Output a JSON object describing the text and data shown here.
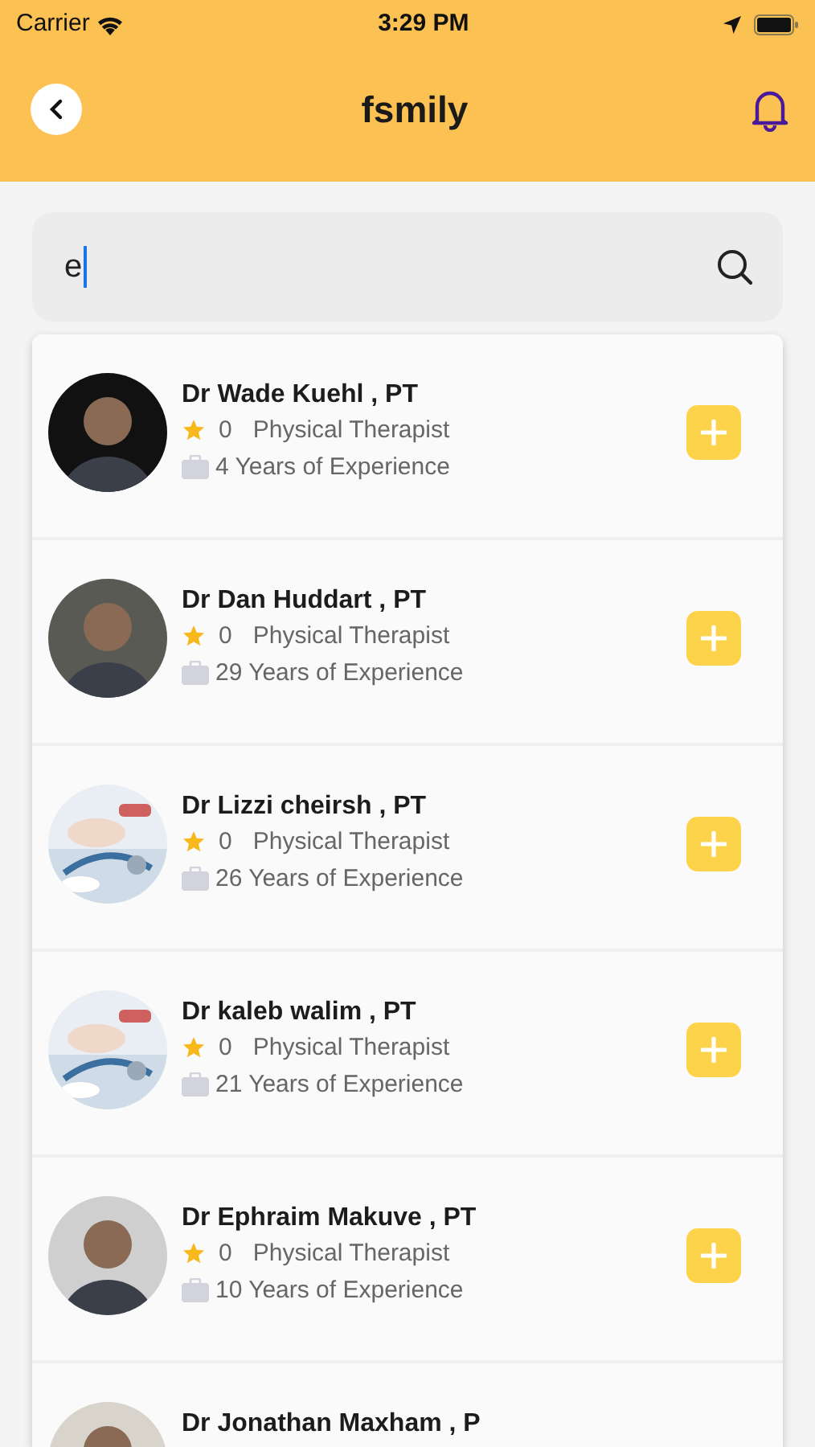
{
  "status_bar": {
    "carrier": "Carrier",
    "time": "3:29 PM"
  },
  "header": {
    "title": "fsmily"
  },
  "search": {
    "value": "e",
    "focused": true
  },
  "doctors": [
    {
      "name": "Dr Wade Kuehl , PT",
      "kind": "person",
      "rating": "0",
      "specialty": "Physical Therapist",
      "experience": "4 Years of Experience"
    },
    {
      "name": "Dr Dan Huddart , PT",
      "kind": "person",
      "rating": "0",
      "specialty": "Physical Therapist",
      "experience": "29 Years of Experience"
    },
    {
      "name": "Dr Lizzi cheirsh , PT",
      "kind": "picture",
      "rating": "0",
      "specialty": "Physical Therapist",
      "experience": "26 Years of Experience"
    },
    {
      "name": "Dr kaleb walim , PT",
      "kind": "picture",
      "rating": "0",
      "specialty": "Physical Therapist",
      "experience": "21 Years of Experience"
    },
    {
      "name": "Dr Ephraim Makuve , PT",
      "kind": "person",
      "rating": "0",
      "specialty": "Physical Therapist",
      "experience": "10 Years of Experience"
    },
    {
      "name": "Dr Jonathan Maxham , P",
      "kind": "person"
    }
  ]
}
